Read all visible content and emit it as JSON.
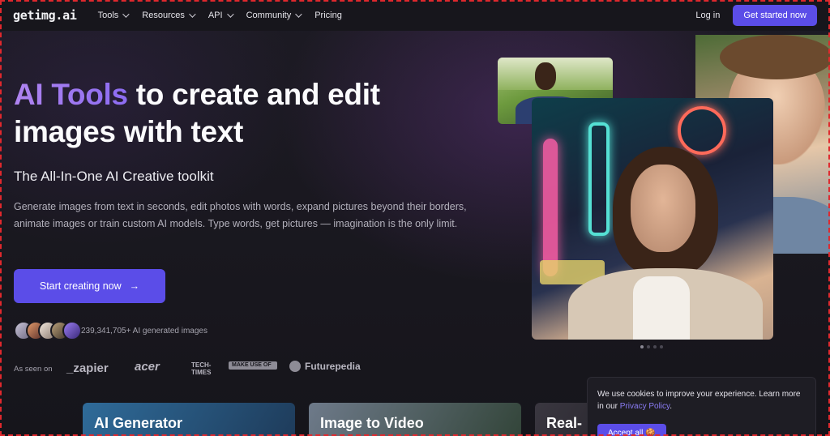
{
  "nav": {
    "logo": "getimg.ai",
    "items": [
      {
        "label": "Tools"
      },
      {
        "label": "Resources"
      },
      {
        "label": "API"
      },
      {
        "label": "Community"
      },
      {
        "label": "Pricing"
      }
    ],
    "login": "Log in",
    "cta": "Get started now"
  },
  "hero": {
    "title_accent": "AI Tools",
    "title_rest_1": " to create and edit",
    "title_rest_2": "images with text",
    "subtitle": "The All-In-One AI Creative toolkit",
    "description": "Generate images from text in seconds, edit photos with words, expand pictures beyond their borders, animate images or train custom AI models. Type words, get pictures — imagination is the only limit.",
    "start_button": "Start creating now",
    "arrow": "→",
    "count_text": "239,341,705+ AI generated images"
  },
  "seen_on": {
    "label": "As seen on",
    "brands": [
      "_zapier",
      "acer",
      "TECH- TIMES",
      "MAKE USE OF",
      "Futurepedia"
    ]
  },
  "cards": [
    {
      "label": "AI Generator"
    },
    {
      "label": "Image to Video"
    },
    {
      "label": "Real-"
    }
  ],
  "cookie": {
    "text": "We use cookies to improve your experience. Learn more in our ",
    "link": "Privacy Policy",
    "tail": ".",
    "accept": "Accept all 🍪"
  },
  "colors": {
    "accent": "#5b4de8",
    "background": "#17161c",
    "gradient_text": "#b084f0"
  }
}
